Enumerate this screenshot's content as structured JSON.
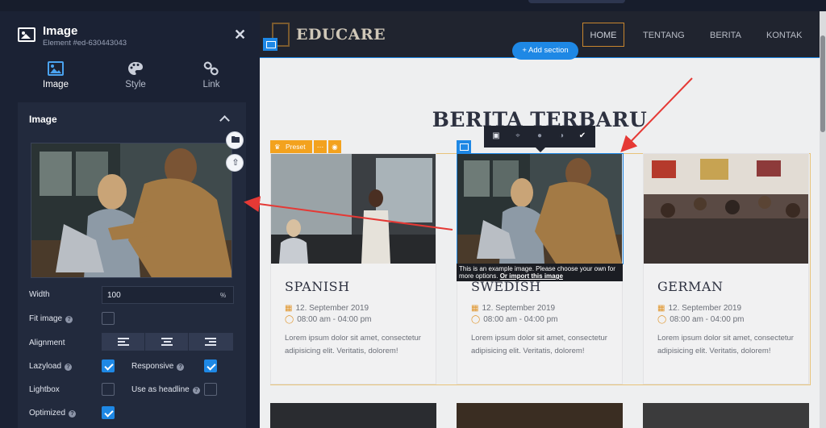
{
  "panel": {
    "title": "Image",
    "element_id": "Element #ed-630443043",
    "close_glyph": "✕",
    "tabs": [
      {
        "label": "Image",
        "icon": "image-icon",
        "active": true
      },
      {
        "label": "Style",
        "icon": "palette-icon",
        "active": false
      },
      {
        "label": "Link",
        "icon": "link-icon",
        "active": false
      }
    ],
    "section_title": "Image",
    "side_buttons": [
      {
        "icon": "folder-icon"
      },
      {
        "icon": "upload-cloud-icon"
      }
    ],
    "fields": {
      "width_label": "Width",
      "width_value": "100",
      "width_unit": "%",
      "fit_image_label": "Fit image",
      "fit_image_checked": false,
      "alignment_label": "Alignment",
      "lazyload_label": "Lazyload",
      "lazyload_checked": true,
      "responsive_label": "Responsive",
      "responsive_checked": true,
      "lightbox_label": "Lightbox",
      "lightbox_checked": false,
      "use_as_headline_label": "Use as headline",
      "use_as_headline_checked": false,
      "optimized_label": "Optimized",
      "optimized_checked": true
    }
  },
  "site": {
    "logo": "EDUCARE",
    "nav": [
      "HOME",
      "TENTANG",
      "BERITA",
      "KONTAK"
    ],
    "active_nav": "HOME",
    "add_section": "+ Add section",
    "heading": "BERITA TERBARU",
    "preset_label": "Preset",
    "image_note": "This is an example image. Please choose your own for more options.",
    "image_note_link": "Or import this image",
    "cards": [
      {
        "title": "SPANISH",
        "date": "12. September 2019",
        "time": "08:00 am - 04:00 pm",
        "desc": "Lorem ipsum dolor sit amet, consectetur adipisicing elit. Veritatis, dolorem!"
      },
      {
        "title": "SWEDISH",
        "date": "12. September 2019",
        "time": "08:00 am - 04:00 pm",
        "desc": "Lorem ipsum dolor sit amet, consectetur adipisicing elit. Veritatis, dolorem!"
      },
      {
        "title": "GERMAN",
        "date": "12. September 2019",
        "time": "08:00 am - 04:00 pm",
        "desc": "Lorem ipsum dolor sit amet, consectetur adipisicing elit. Veritatis, dolorem!"
      }
    ]
  },
  "colors": {
    "accent": "#1e88e5",
    "arrow": "#e53935",
    "preset": "#f3a21e",
    "panel_bg": "#1b2234"
  }
}
